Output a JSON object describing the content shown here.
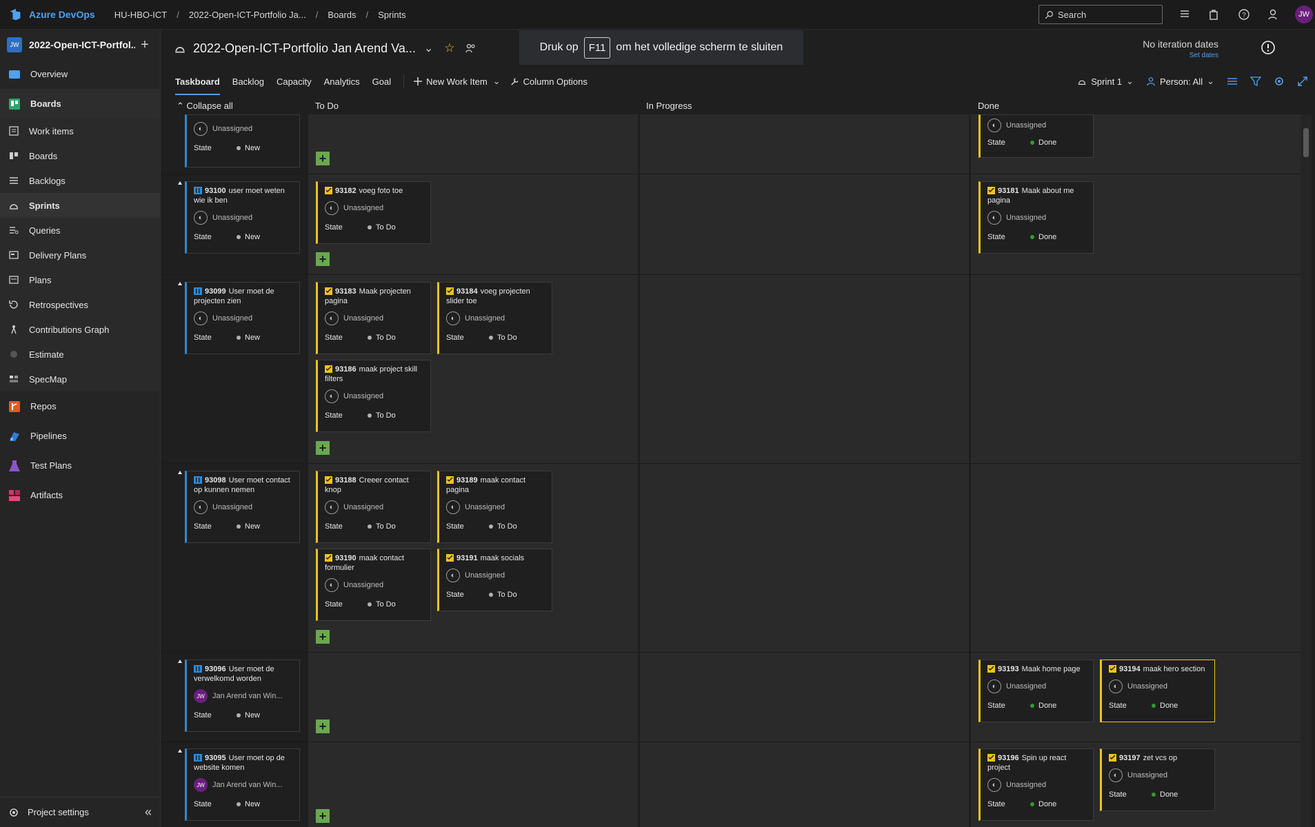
{
  "header": {
    "brand": "Azure DevOps",
    "breadcrumbs": [
      "HU-HBO-ICT",
      "2022-Open-ICT-Portfolio Ja...",
      "Boards",
      "Sprints"
    ],
    "search_placeholder": "Search",
    "user_initials": "JW"
  },
  "sidebar": {
    "project_badge": "JW",
    "project_name": "2022-Open-ICT-Portfol...",
    "items": [
      {
        "label": "Overview"
      },
      {
        "label": "Boards"
      },
      {
        "label": "Work items"
      },
      {
        "label": "Boards"
      },
      {
        "label": "Backlogs"
      },
      {
        "label": "Sprints"
      },
      {
        "label": "Queries"
      },
      {
        "label": "Delivery Plans"
      },
      {
        "label": "Plans"
      },
      {
        "label": "Retrospectives"
      },
      {
        "label": "Contributions Graph"
      },
      {
        "label": "Estimate"
      },
      {
        "label": "SpecMap"
      },
      {
        "label": "Repos"
      },
      {
        "label": "Pipelines"
      },
      {
        "label": "Test Plans"
      },
      {
        "label": "Artifacts"
      }
    ],
    "settings_label": "Project settings"
  },
  "page": {
    "title": "2022-Open-ICT-Portfolio Jan Arend Va...",
    "toast": {
      "before": "Druk op",
      "key": "F11",
      "after": "om het volledige scherm te sluiten"
    },
    "iteration_dates": "No iteration dates",
    "set_dates": "Set dates",
    "tabs": [
      "Taskboard",
      "Backlog",
      "Capacity",
      "Analytics",
      "Goal"
    ],
    "new_work_item": "New Work Item",
    "column_options": "Column Options",
    "sprint_picker": "Sprint 1",
    "person_filter": "Person: All"
  },
  "board": {
    "collapse_all": "Collapse all",
    "columns": [
      "To Do",
      "In Progress",
      "Done"
    ],
    "state_label": "State",
    "cards": {
      "s0": {
        "title": "",
        "assignee": "Unassigned",
        "state": "New"
      },
      "d0": {
        "title": "",
        "assignee": "Unassigned",
        "state": "Done"
      },
      "s93100": {
        "id": "93100",
        "title": "user moet weten wie ik ben",
        "assignee": "Unassigned",
        "state": "New"
      },
      "t93182": {
        "id": "93182",
        "title": "voeg foto toe",
        "assignee": "Unassigned",
        "state": "To Do"
      },
      "t93181": {
        "id": "93181",
        "title": "Maak about me pagina",
        "assignee": "Unassigned",
        "state": "Done"
      },
      "s93099": {
        "id": "93099",
        "title": "User moet de projecten zien",
        "assignee": "Unassigned",
        "state": "New"
      },
      "t93183": {
        "id": "93183",
        "title": "Maak projecten pagina",
        "assignee": "Unassigned",
        "state": "To Do"
      },
      "t93184": {
        "id": "93184",
        "title": "voeg projecten slider toe",
        "assignee": "Unassigned",
        "state": "To Do"
      },
      "t93186": {
        "id": "93186",
        "title": "maak project skill filters",
        "assignee": "Unassigned",
        "state": "To Do"
      },
      "s93098": {
        "id": "93098",
        "title": "User moet contact op kunnen nemen",
        "assignee": "Unassigned",
        "state": "New"
      },
      "t93188": {
        "id": "93188",
        "title": "Creeer contact knop",
        "assignee": "Unassigned",
        "state": "To Do"
      },
      "t93189": {
        "id": "93189",
        "title": "maak contact pagina",
        "assignee": "Unassigned",
        "state": "To Do"
      },
      "t93190": {
        "id": "93190",
        "title": "maak contact formulier",
        "assignee": "Unassigned",
        "state": "To Do"
      },
      "t93191": {
        "id": "93191",
        "title": "maak socials",
        "assignee": "Unassigned",
        "state": "To Do"
      },
      "s93096": {
        "id": "93096",
        "title": "User moet de verwelkomd worden",
        "assignee": "Jan Arend van Win...",
        "assignee_initials": "JW",
        "state": "New"
      },
      "t93193": {
        "id": "93193",
        "title": "Maak home page",
        "assignee": "Unassigned",
        "state": "Done"
      },
      "t93194": {
        "id": "93194",
        "title": "maak hero section",
        "assignee": "Unassigned",
        "state": "Done"
      },
      "s93095": {
        "id": "93095",
        "title": "User moet op de website komen",
        "assignee": "Jan Arend van Win...",
        "assignee_initials": "JW",
        "state": "New"
      },
      "t93196": {
        "id": "93196",
        "title": "Spin up react project",
        "assignee": "Unassigned",
        "state": "Done"
      },
      "t93197": {
        "id": "93197",
        "title": "zet vcs op",
        "assignee": "Unassigned",
        "state": "Done"
      }
    }
  },
  "colors": {
    "accent": "#4ea1f3",
    "story": "#2b8ad8",
    "task": "#f0c419",
    "done": "#339933",
    "add": "#6aa84f"
  }
}
